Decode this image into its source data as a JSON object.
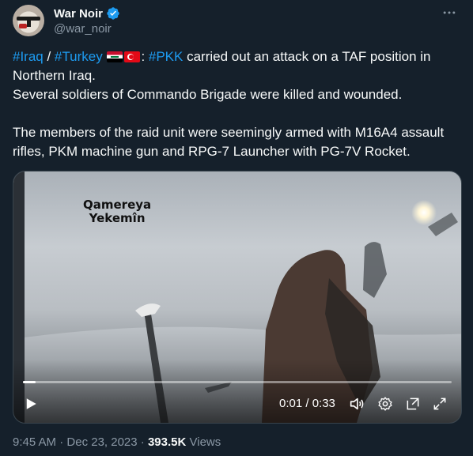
{
  "author": {
    "display_name": "War Noir",
    "handle": "@war_noir",
    "verified": true,
    "more_icon": "more-dots-icon"
  },
  "tweet": {
    "line1": {
      "tag_iraq": "#Iraq",
      "slash": " / ",
      "tag_turkey": "#Turkey",
      "colon": ": ",
      "tag_pkk": "#PKK",
      "rest": " carried out an attack on a TAF position in Northern Iraq."
    },
    "line2": "Several soldiers of Commando Brigade were killed and wounded.",
    "line3": "The members of the raid unit were seemingly armed with M16A4 assault rifles, PKM machine gun and RPG-7 Launcher with PG-7V Rocket."
  },
  "video": {
    "overlay_line1": "Qamereya",
    "overlay_line2": "Yekemîn",
    "time_display": "0:01 / 0:33",
    "progress": 0.03
  },
  "footer": {
    "time": "9:45 AM",
    "separator": " · ",
    "date": "Dec 23, 2023",
    "views_count": "393.5K",
    "views_label": " Views"
  },
  "colors": {
    "background": "#15202b",
    "link": "#1d9bf0",
    "secondary_text": "#8b98a5",
    "primary_text": "#f7f9f9"
  }
}
